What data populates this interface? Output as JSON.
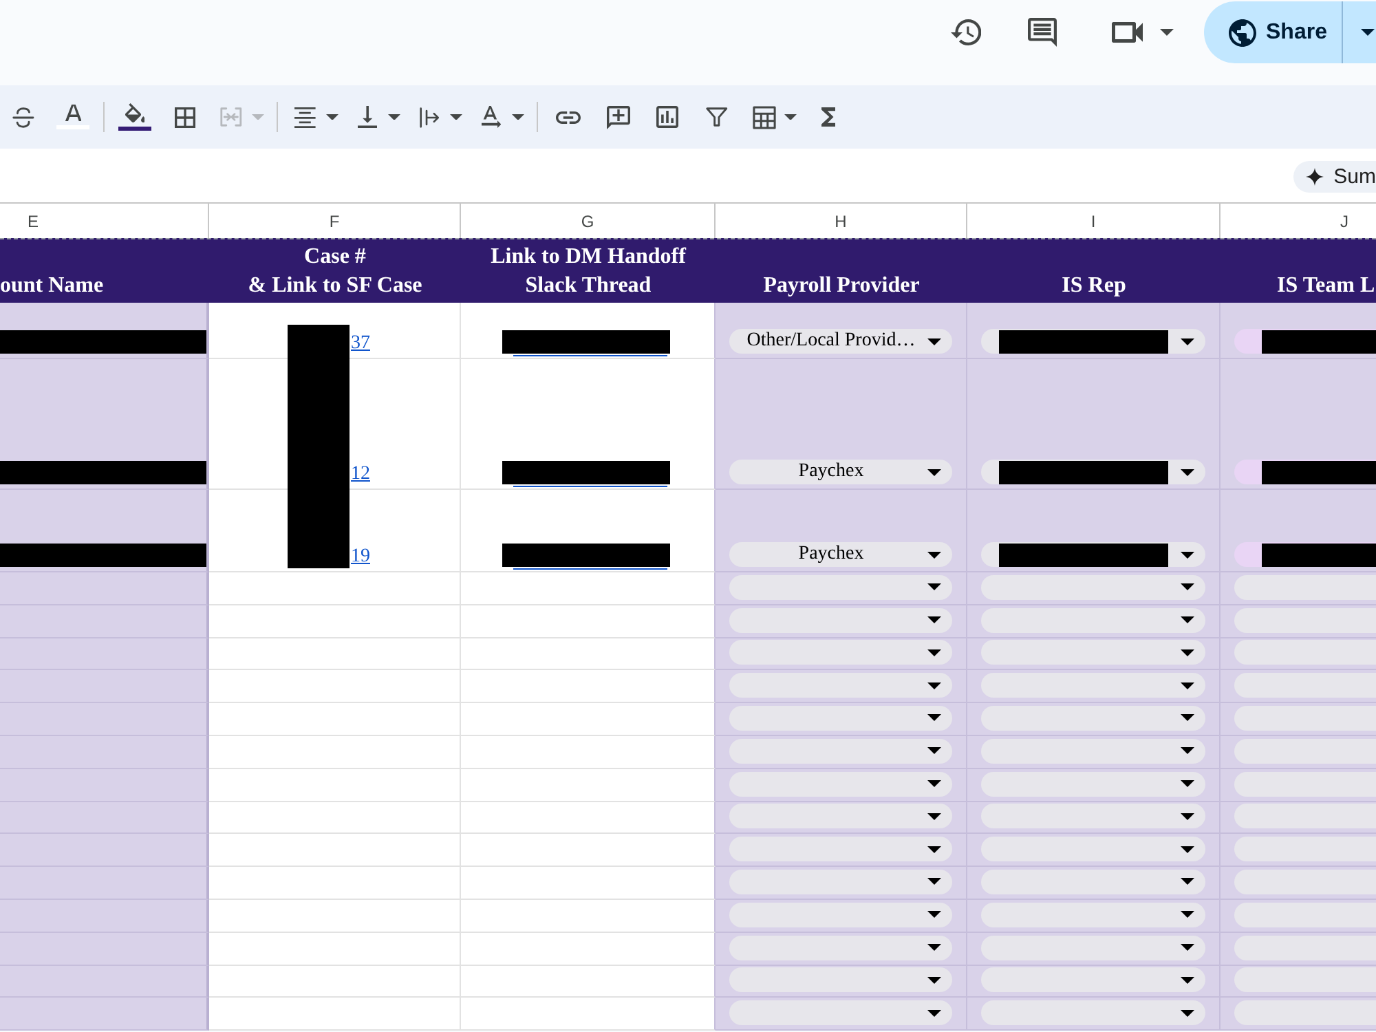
{
  "top_actions": [
    {
      "kind": "history",
      "menu": false
    },
    {
      "kind": "comments",
      "menu": false
    },
    {
      "kind": "meet",
      "menu": true
    }
  ],
  "share": {
    "label": "Share"
  },
  "toolbar": [
    [
      {
        "kind": "strikethrough",
        "menu": false,
        "disabled": false
      },
      {
        "kind": "text-color",
        "menu": false,
        "disabled": false,
        "color": "#ffffff"
      }
    ],
    [
      {
        "kind": "fill-color",
        "menu": false,
        "disabled": false,
        "color": "#351c75"
      },
      {
        "kind": "borders",
        "menu": false,
        "disabled": false
      },
      {
        "kind": "merge",
        "menu": true,
        "disabled": true
      }
    ],
    [
      {
        "kind": "align",
        "menu": true,
        "disabled": false
      },
      {
        "kind": "valign",
        "menu": true,
        "disabled": false
      },
      {
        "kind": "wrap",
        "menu": true,
        "disabled": false
      },
      {
        "kind": "rotate",
        "menu": true,
        "disabled": false
      }
    ],
    [
      {
        "kind": "link",
        "menu": false,
        "disabled": false
      },
      {
        "kind": "comment",
        "menu": false,
        "disabled": false
      },
      {
        "kind": "chart",
        "menu": false,
        "disabled": false
      },
      {
        "kind": "filter",
        "menu": false,
        "disabled": false
      },
      {
        "kind": "table",
        "menu": true,
        "disabled": false
      },
      {
        "kind": "functions",
        "menu": false,
        "disabled": false
      }
    ]
  ],
  "summarize": {
    "label": "Sum"
  },
  "sheet": {
    "columns": [
      {
        "letter": "E",
        "header": "ount Name",
        "kind": "account"
      },
      {
        "letter": "F",
        "header": "Case #\n& Link to SF Case",
        "kind": "case"
      },
      {
        "letter": "G",
        "header": "Link to DM Handoff\nSlack Thread",
        "kind": "thread"
      },
      {
        "letter": "H",
        "header": "Payroll Provider",
        "kind": "payroll"
      },
      {
        "letter": "I",
        "header": "IS Rep",
        "kind": "rep"
      },
      {
        "letter": "J",
        "header": "IS Team L",
        "kind": "team"
      }
    ],
    "rows": [
      {
        "redacted": [
          true,
          true,
          true,
          false,
          true,
          true
        ],
        "case_link": "37",
        "payroll": "Other/Local Provid…",
        "team_chip": {
          "color": "#e9d5f5"
        }
      },
      {
        "redacted": [
          true,
          true,
          true,
          false,
          true,
          true
        ],
        "case_link": "12",
        "payroll": "Paychex",
        "team_chip": {
          "color": "#e9d5f5"
        }
      },
      {
        "redacted": [
          true,
          true,
          true,
          false,
          true,
          true
        ],
        "case_link": "19",
        "payroll": "Paychex",
        "team_chip": {
          "color": "#e9d5f5"
        }
      },
      {
        "redacted": [
          false,
          false,
          false,
          false,
          false,
          false
        ]
      },
      {
        "redacted": [
          false,
          false,
          false,
          false,
          false,
          false
        ]
      },
      {
        "redacted": [
          false,
          false,
          false,
          false,
          false,
          false
        ]
      },
      {
        "redacted": [
          false,
          false,
          false,
          false,
          false,
          false
        ]
      },
      {
        "redacted": [
          false,
          false,
          false,
          false,
          false,
          false
        ]
      },
      {
        "redacted": [
          false,
          false,
          false,
          false,
          false,
          false
        ]
      },
      {
        "redacted": [
          false,
          false,
          false,
          false,
          false,
          false
        ]
      },
      {
        "redacted": [
          false,
          false,
          false,
          false,
          false,
          false
        ]
      },
      {
        "redacted": [
          false,
          false,
          false,
          false,
          false,
          false
        ]
      },
      {
        "redacted": [
          false,
          false,
          false,
          false,
          false,
          false
        ]
      },
      {
        "redacted": [
          false,
          false,
          false,
          false,
          false,
          false
        ]
      },
      {
        "redacted": [
          false,
          false,
          false,
          false,
          false,
          false
        ]
      },
      {
        "redacted": [
          false,
          false,
          false,
          false,
          false,
          false
        ]
      },
      {
        "redacted": [
          false,
          false,
          false,
          false,
          false,
          false
        ]
      }
    ]
  }
}
